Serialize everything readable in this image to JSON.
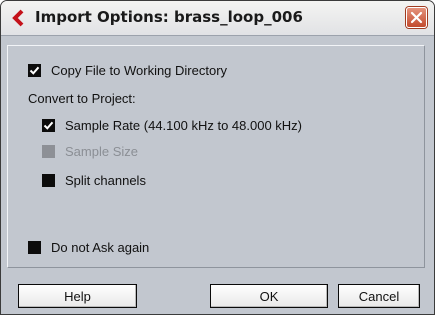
{
  "window": {
    "title": "Import Options: brass_loop_006",
    "app_icon": "cubase-logo-icon",
    "close_icon": "close-icon"
  },
  "options": {
    "copy_file": {
      "label": "Copy File to Working Directory",
      "checked": true,
      "enabled": true
    },
    "convert_heading": "Convert to Project:",
    "sample_rate": {
      "label": "Sample Rate (44.100 kHz to 48.000 kHz)",
      "checked": true,
      "enabled": true
    },
    "sample_size": {
      "label": "Sample Size",
      "checked": false,
      "enabled": false
    },
    "split_channels": {
      "label": "Split channels",
      "checked": false,
      "enabled": true
    },
    "do_not_ask": {
      "label": "Do not Ask again",
      "checked": false,
      "enabled": true
    }
  },
  "buttons": {
    "help": "Help",
    "ok": "OK",
    "cancel": "Cancel"
  },
  "colors": {
    "dialog_bg": "#c2c7cf",
    "close_button": "#c24a2e",
    "logo_red": "#c4121a"
  }
}
